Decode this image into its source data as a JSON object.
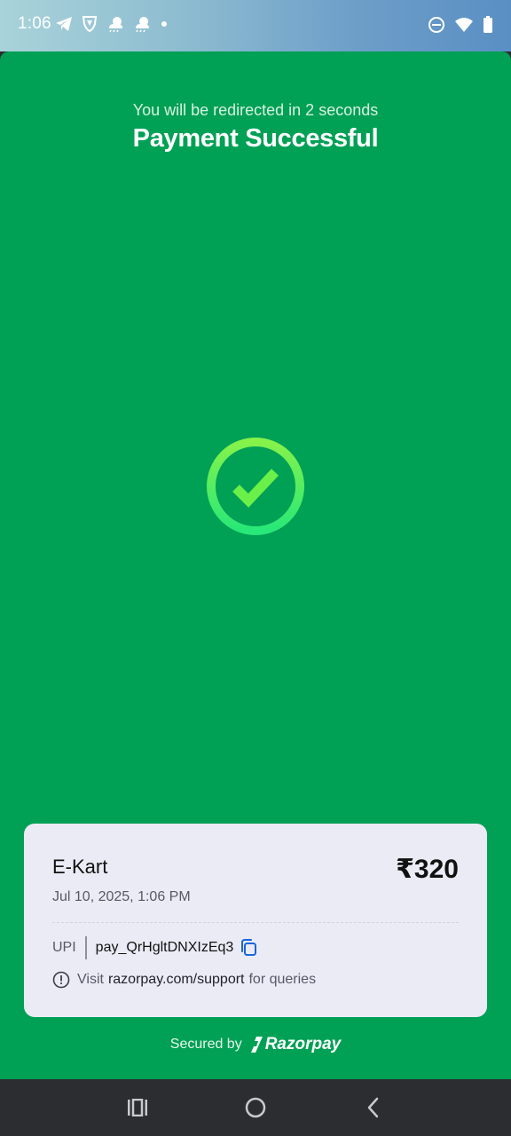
{
  "status_bar": {
    "time": "1:06",
    "left_icons": [
      "telegram-icon",
      "vpn-shield-icon",
      "cloud-weather-icon",
      "cloud-weather-icon",
      "dot-icon"
    ],
    "right_icons": [
      "do-not-disturb-icon",
      "wifi-icon",
      "battery-icon"
    ]
  },
  "page": {
    "redirect_text": "You will be redirected in 2 seconds",
    "title": "Payment Successful",
    "status_icon": "check-circle-icon"
  },
  "receipt": {
    "merchant": "E-Kart",
    "amount": "₹320",
    "date": "Jul 10, 2025, 1:06 PM",
    "method_label": "UPI",
    "payment_id": "pay_QrHgltDNXIzEq3",
    "support_prefix": "Visit",
    "support_link": "razorpay.com/support",
    "support_suffix": "for queries"
  },
  "footer": {
    "secured_label": "Secured by",
    "brand": "Razorpay"
  },
  "nav": {
    "buttons": [
      "recents-icon",
      "home-icon",
      "back-icon"
    ]
  },
  "colors": {
    "background_green": "#00a055",
    "card_bg": "#ebebf6",
    "check_green": "#7cf54b",
    "nav_bg": "#2b2d31",
    "link_blue": "#1a66d8"
  }
}
